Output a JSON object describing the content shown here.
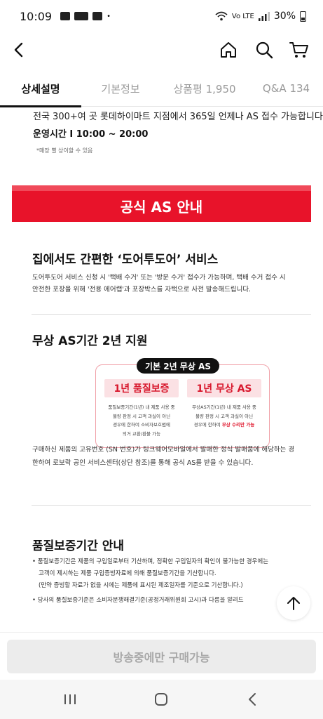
{
  "status_bar": {
    "time": "10:09",
    "dot": "•",
    "network": "Vo LTE",
    "battery": "30%"
  },
  "header": {
    "icons": [
      "back-icon",
      "home-icon",
      "search-icon",
      "cart-icon"
    ]
  },
  "tabs": [
    {
      "label": "상세설명",
      "active": true
    },
    {
      "label": "기본정보",
      "active": false
    },
    {
      "label": "상품평 1,950",
      "active": false
    },
    {
      "label": "Q&A 134",
      "active": false
    }
  ],
  "content": {
    "store_line": "전국 300+여 곳 롯데하이마트 지점에서 365일 언제나 AS 접수 가능합니다",
    "hours_line": "운영시간 I 10:00 ~ 20:00",
    "hours_note": "*매장 별 상이할 수 있음",
    "banner": "공식 AS 안내",
    "door": {
      "title": "집에서도 간편한 ‘도어투도어’ 서비스",
      "desc": [
        "도어투도어 서비스 신청 시 '택배 수거' 또는 '방문 수거' 접수가 가능하며, 택배 수거 접수 시",
        "안전한 포장을 위해 '전용 에어캡'과 포장박스를 자택으로 사전 발송해드립니다."
      ]
    },
    "warranty": {
      "title": "무상 AS기간 2년 지원",
      "badge": "기본 2년 무상 AS",
      "left": {
        "head": "1년 품질보증",
        "lines": [
          "품질보증기간(1년) 내 제품 사용 중",
          "불량 판정 시 고객 과실이 아닌",
          "경우에 한하여 소비자보호법에",
          "의거 교환/환불 가능"
        ]
      },
      "right": {
        "head": "1년 무상 AS",
        "lines": [
          "무상AS기간(1년) 내 제품 사용 중",
          "불량 판정 시 고객 과실이 아닌"
        ],
        "last_prefix": "경우에 한하여 ",
        "last_highlight": "무상 수리만 가능"
      }
    },
    "sn_lines": [
      "구매하신 제품의 고유번호 (SN 번호)가 팅크웨어모바일에서 발매한 정식 발매품에 해당하는 경",
      "한하여 로보락 공인 서비스센터(상단 참조)를 통해 공식 AS를 받을 수 있습니다."
    ],
    "quality": {
      "title": "품질보증기간 안내",
      "bullet1": [
        "품질보증기간은 제품의 구입일로부터 기산하며, 정확한 구입일자의 확인이 불가능한 경우에는",
        "고객이 제시하는 제품 구입증빙자료에 의해 품질보증기간을 기산합니다.",
        "(만약 증빙할 자료가 없을 시에는 제품에 표시된 제조일자를 기준으로 기산합니다.)"
      ],
      "bullet2": "당사의 품질보증기준은 소비자분쟁해결기준(공정거래위원회 고시)과 다름을 알려드"
    }
  },
  "bottom": {
    "buy_label": "방송중에만 구매가능"
  }
}
